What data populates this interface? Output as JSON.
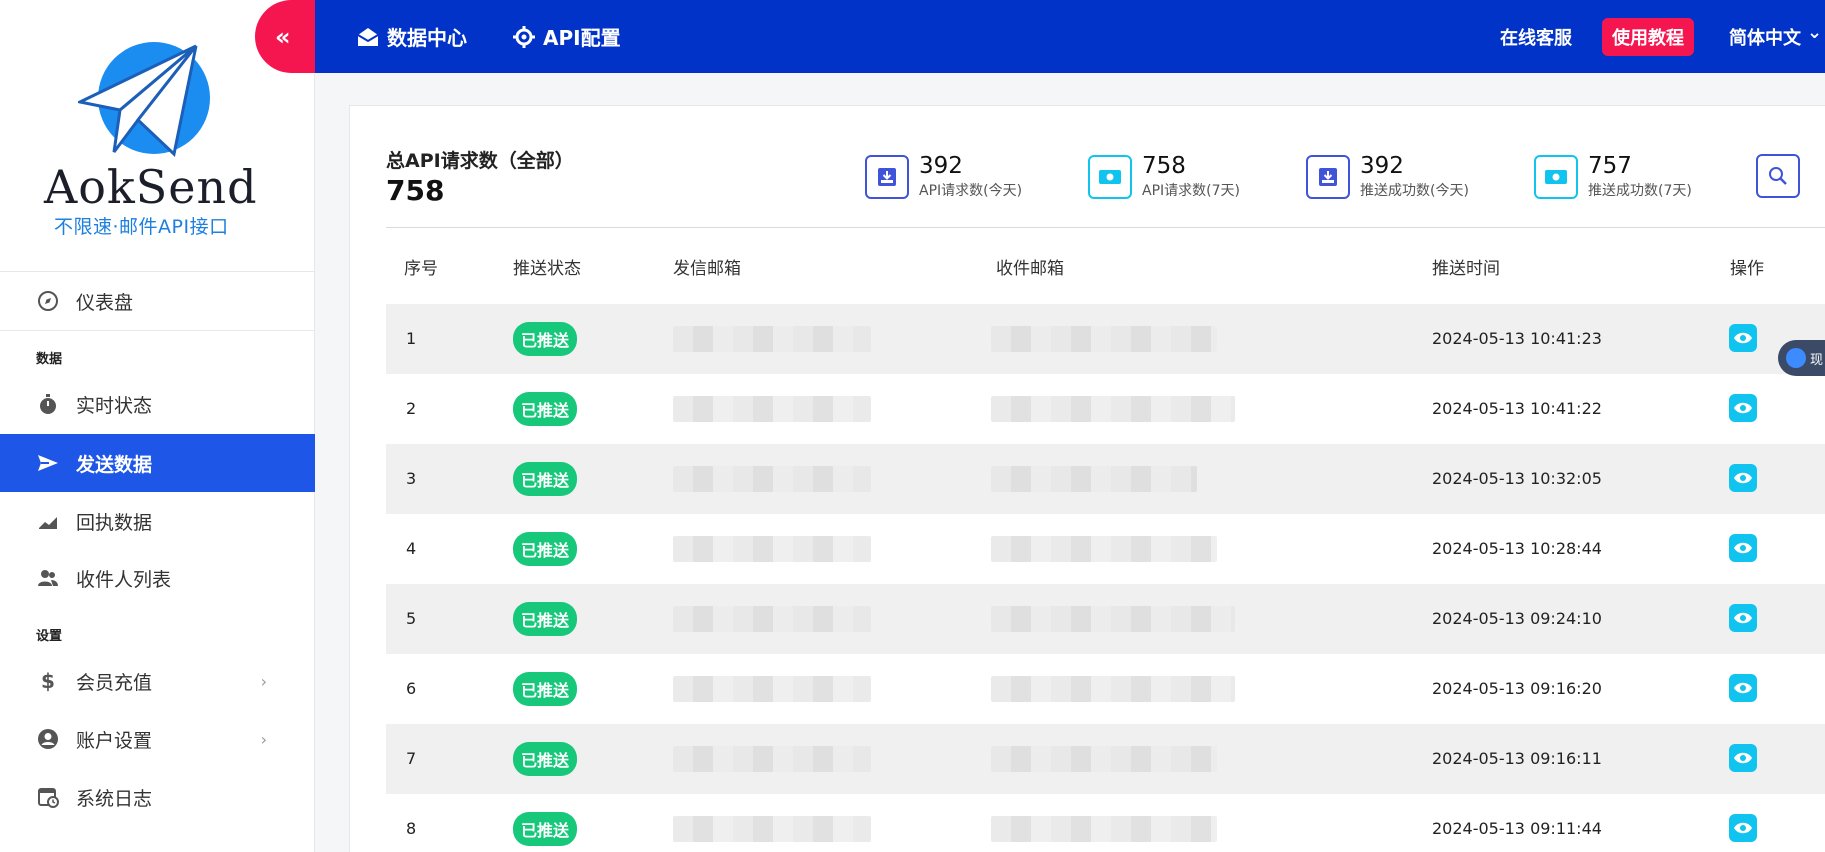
{
  "brand": {
    "name": "AokSend",
    "slogan": "不限速·邮件API接口"
  },
  "collapse": {
    "label": "«"
  },
  "sidebar": {
    "dashboard": "仪表盘",
    "section_data": "数据",
    "items": [
      {
        "label": "实时状态",
        "icon": "stopwatch-icon"
      },
      {
        "label": "发送数据",
        "icon": "send-icon"
      },
      {
        "label": "回执数据",
        "icon": "chart-icon"
      },
      {
        "label": "收件人列表",
        "icon": "people-icon"
      }
    ],
    "section_settings": "设置",
    "settings": [
      {
        "label": "会员充值",
        "icon": "dollar-icon"
      },
      {
        "label": "账户设置",
        "icon": "account-icon"
      },
      {
        "label": "系统日志",
        "icon": "calendar-icon"
      }
    ],
    "chevron": "›"
  },
  "topbar": {
    "tabs": [
      "数据中心",
      "API配置"
    ],
    "support": "在线客服",
    "tutorial": "使用教程",
    "language": "简体中文",
    "language_arrow": "⌄"
  },
  "summary": {
    "total_label": "总API请求数（全部）",
    "total_value": "758",
    "stats": [
      {
        "value": "392",
        "label": "API请求数(今天)",
        "color": "#3f54d8"
      },
      {
        "value": "758",
        "label": "API请求数(7天)",
        "color": "#11c4ef"
      },
      {
        "value": "392",
        "label": "推送成功数(今天)",
        "color": "#3f54d8"
      },
      {
        "value": "757",
        "label": "推送成功数(7天)",
        "color": "#11c4ef"
      }
    ]
  },
  "table": {
    "headers": [
      "序号",
      "推送状态",
      "发信邮箱",
      "收件邮箱",
      "推送时间",
      "操作"
    ],
    "rows": [
      {
        "idx": "1",
        "status": "已推送",
        "time": "2024-05-13 10:41:23"
      },
      {
        "idx": "2",
        "status": "已推送",
        "time": "2024-05-13 10:41:22"
      },
      {
        "idx": "3",
        "status": "已推送",
        "time": "2024-05-13 10:32:05"
      },
      {
        "idx": "4",
        "status": "已推送",
        "time": "2024-05-13 10:28:44"
      },
      {
        "idx": "5",
        "status": "已推送",
        "time": "2024-05-13 09:24:10"
      },
      {
        "idx": "6",
        "status": "已推送",
        "time": "2024-05-13 09:16:20"
      },
      {
        "idx": "7",
        "status": "已推送",
        "time": "2024-05-13 09:16:11"
      },
      {
        "idx": "8",
        "status": "已推送",
        "time": "2024-05-13 09:11:44"
      }
    ]
  },
  "float": {
    "label": "现"
  },
  "colors": {
    "topbar": "#0233c8",
    "accent_red": "#f5164f",
    "active_nav": "#1e56e8",
    "success": "#17c87b",
    "view_icon": "#11c4ef"
  }
}
